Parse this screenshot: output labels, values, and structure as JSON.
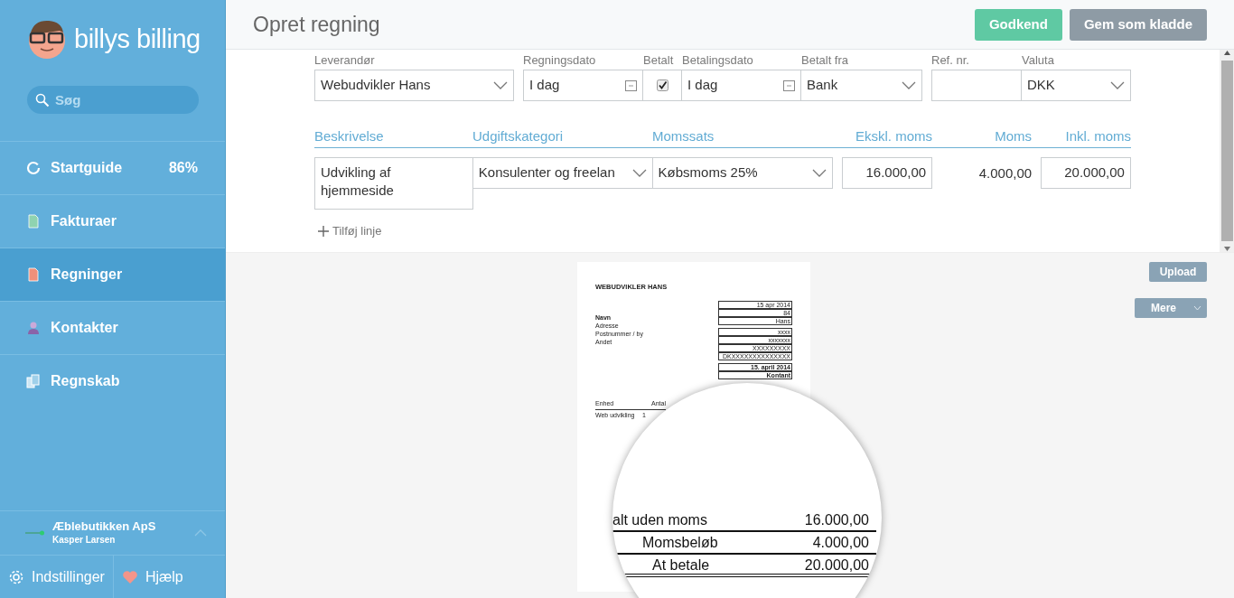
{
  "sidebar": {
    "logo_text": "billys billing",
    "search": {
      "placeholder": "Søg"
    },
    "items": [
      {
        "label": "Startguide",
        "badge": "86%",
        "selected": false
      },
      {
        "label": "Fakturaer",
        "selected": false
      },
      {
        "label": "Regninger",
        "selected": true
      },
      {
        "label": "Kontakter",
        "selected": false
      },
      {
        "label": "Regnskab",
        "selected": false
      }
    ],
    "company": {
      "name": "Æblebutikken ApS",
      "user": "Kasper Larsen"
    },
    "footer": [
      {
        "label": "Indstillinger"
      },
      {
        "label": "Hjælp"
      }
    ]
  },
  "header": {
    "title": "Opret regning",
    "buttons": [
      {
        "label": "Godkend",
        "kind": "primary"
      },
      {
        "label": "Gem som kladde",
        "kind": "secondary"
      }
    ]
  },
  "fields": [
    {
      "label": "Leverandør",
      "kind": "select",
      "value": "Webudvikler Hans"
    },
    {
      "label": "Regningsdato",
      "kind": "date",
      "value": "I dag"
    },
    {
      "label": "Betalt",
      "kind": "checkbox",
      "checked": true
    },
    {
      "label": "Betalingsdato",
      "kind": "date",
      "value": "I dag"
    },
    {
      "label": "Betalt fra",
      "kind": "select",
      "value": "Bank"
    },
    {
      "label": "Ref. nr.",
      "kind": "text"
    },
    {
      "label": "Valuta",
      "kind": "select",
      "value": "DKK"
    }
  ],
  "lines": {
    "columns": [
      "Beskrivelse",
      "Udgiftskategori",
      "Momssats",
      "Ekskl. moms",
      "Moms",
      "Inkl. moms"
    ],
    "rows": [
      {
        "description": "Udvikling af hjemmeside",
        "category": "Konsulenter og freelan ",
        "vat_rate": "Købsmoms 25%",
        "excl": "16.000,00",
        "vat": "4.000,00",
        "incl": "20.000,00"
      }
    ],
    "add_line": "Tilføj linje"
  },
  "attachment": {
    "buttons": [
      {
        "label": "Upload",
        "kind": "plain"
      },
      {
        "label": "Mere",
        "kind": "dropdown"
      }
    ],
    "document": {
      "title": "WEBUDVIKLER HANS",
      "address": [
        "Navn",
        "Adresse",
        "Postnummer / by",
        "Andet"
      ],
      "info_groups": [
        [
          "15 apr 2014",
          "84",
          "Hans"
        ],
        [
          "xxxx",
          "xxxxxxx",
          "XXXXXXXXX",
          "DKXXXXXXXXXXXXXX"
        ],
        [
          "15. april 2014",
          "Kontant"
        ]
      ],
      "table_header": [
        "Enhed",
        "Antal"
      ],
      "table_row": [
        "Web udvikling",
        "1"
      ],
      "magnified": [
        {
          "label": "alt uden moms",
          "value": "16.000,00"
        },
        {
          "label": "Momsbeløb",
          "value": "4.000,00"
        },
        {
          "label": "At betale",
          "value": "20.000,00"
        }
      ]
    }
  }
}
